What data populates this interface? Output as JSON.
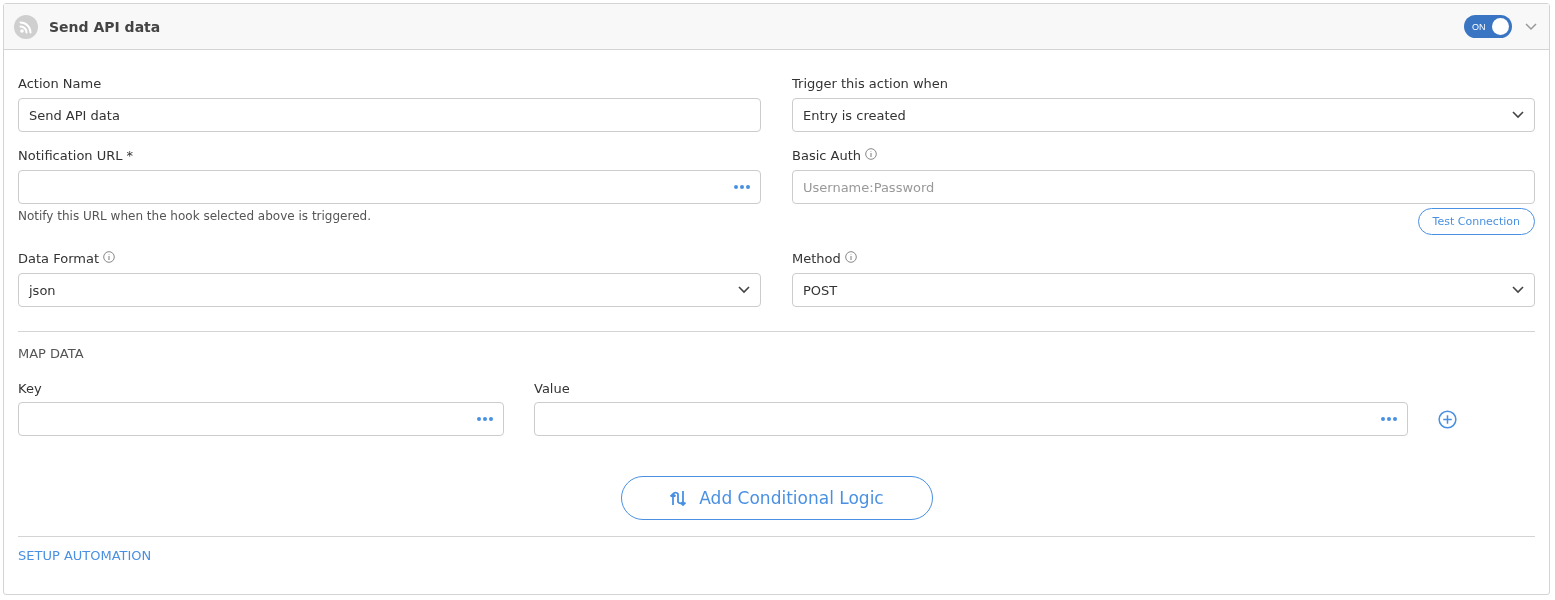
{
  "header": {
    "title": "Send API data",
    "toggle": {
      "label": "ON",
      "on": true
    }
  },
  "fields": [
    {
      "label": "Action Name",
      "kind": "text",
      "value": "Send API data"
    },
    {
      "label": "Trigger this action when",
      "kind": "select",
      "value": "Entry is created"
    },
    {
      "label": "Notification URL",
      "required_mark": "*",
      "kind": "dots",
      "help": "Notify this URL when the hook selected above is triggered."
    },
    {
      "label": "Basic Auth",
      "info": true,
      "kind": "text",
      "placeholder": "Username:Password",
      "button": "Test Connection"
    },
    {
      "label": "Data Format",
      "info": true,
      "kind": "select",
      "value": "json"
    },
    {
      "label": "Method",
      "info": true,
      "kind": "select",
      "value": "POST"
    }
  ],
  "map_data": {
    "title": "MAP DATA",
    "columns": [
      "Key",
      "Value"
    ]
  },
  "conditional_button": "Add Conditional Logic",
  "setup_automation": "SETUP AUTOMATION"
}
